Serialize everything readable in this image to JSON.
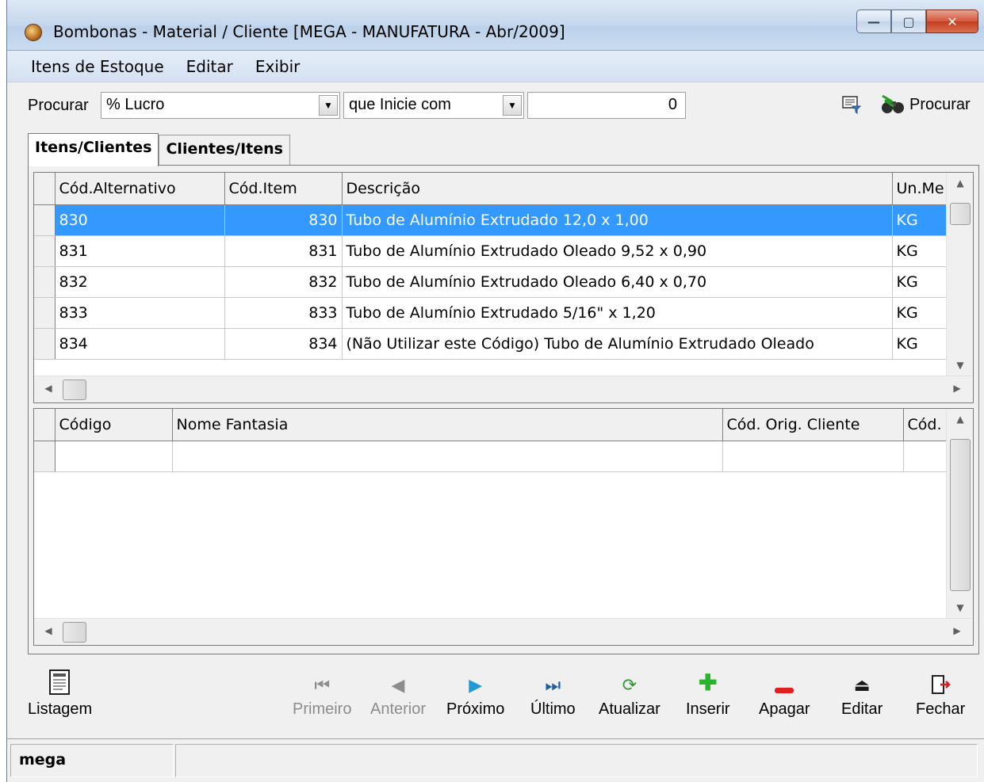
{
  "window": {
    "title": "Bombonas -  Material / Cliente [MEGA - MANUFATURA - Abr/2009]",
    "controls": {
      "minimize": "—",
      "maximize": "▢",
      "close": "✕"
    }
  },
  "menu": {
    "items": [
      "Itens de Estoque",
      "Editar",
      "Exibir"
    ]
  },
  "search": {
    "label": "Procurar",
    "field_value": "% Lucro",
    "operator_value": "que Inicie com",
    "search_value": "0",
    "search_button": "Procurar"
  },
  "tabs": [
    {
      "label": "Itens/Clientes",
      "active": true
    },
    {
      "label": "Clientes/Itens",
      "active": false
    }
  ],
  "items_grid": {
    "columns": [
      "Cód.Alternativo",
      "Cód.Item",
      "Descrição",
      "Un.Me"
    ],
    "rows": [
      {
        "alt": "830",
        "item": "830",
        "desc": "Tubo de Alumínio Extrudado 12,0 x 1,00",
        "un": "KG",
        "selected": true
      },
      {
        "alt": "831",
        "item": "831",
        "desc": "Tubo de Alumínio Extrudado Oleado 9,52 x 0,90",
        "un": "KG",
        "selected": false
      },
      {
        "alt": "832",
        "item": "832",
        "desc": "Tubo de Alumínio Extrudado Oleado 6,40 x 0,70",
        "un": "KG",
        "selected": false
      },
      {
        "alt": "833",
        "item": "833",
        "desc": "Tubo de Alumínio Extrudado 5/16\" x 1,20",
        "un": "KG",
        "selected": false
      },
      {
        "alt": "834",
        "item": "834",
        "desc": "(Não Utilizar este Código) Tubo de Alumínio Extrudado Oleado",
        "un": "KG",
        "selected": false
      }
    ]
  },
  "clients_grid": {
    "columns": [
      "Código",
      "Nome Fantasia",
      "Cód. Orig. Cliente",
      "Cód."
    ]
  },
  "nav_buttons": {
    "listagem": "Listagem",
    "primeiro": "Primeiro",
    "anterior": "Anterior",
    "proximo": "Próximo",
    "ultimo": "Último",
    "atualizar": "Atualizar",
    "inserir": "Inserir",
    "apagar": "Apagar",
    "editar": "Editar",
    "fechar": "Fechar"
  },
  "status": {
    "user": "mega"
  },
  "colors": {
    "selection": "#3399ff",
    "title_bar": "#c7d9ee",
    "close_button": "#d4553a"
  }
}
